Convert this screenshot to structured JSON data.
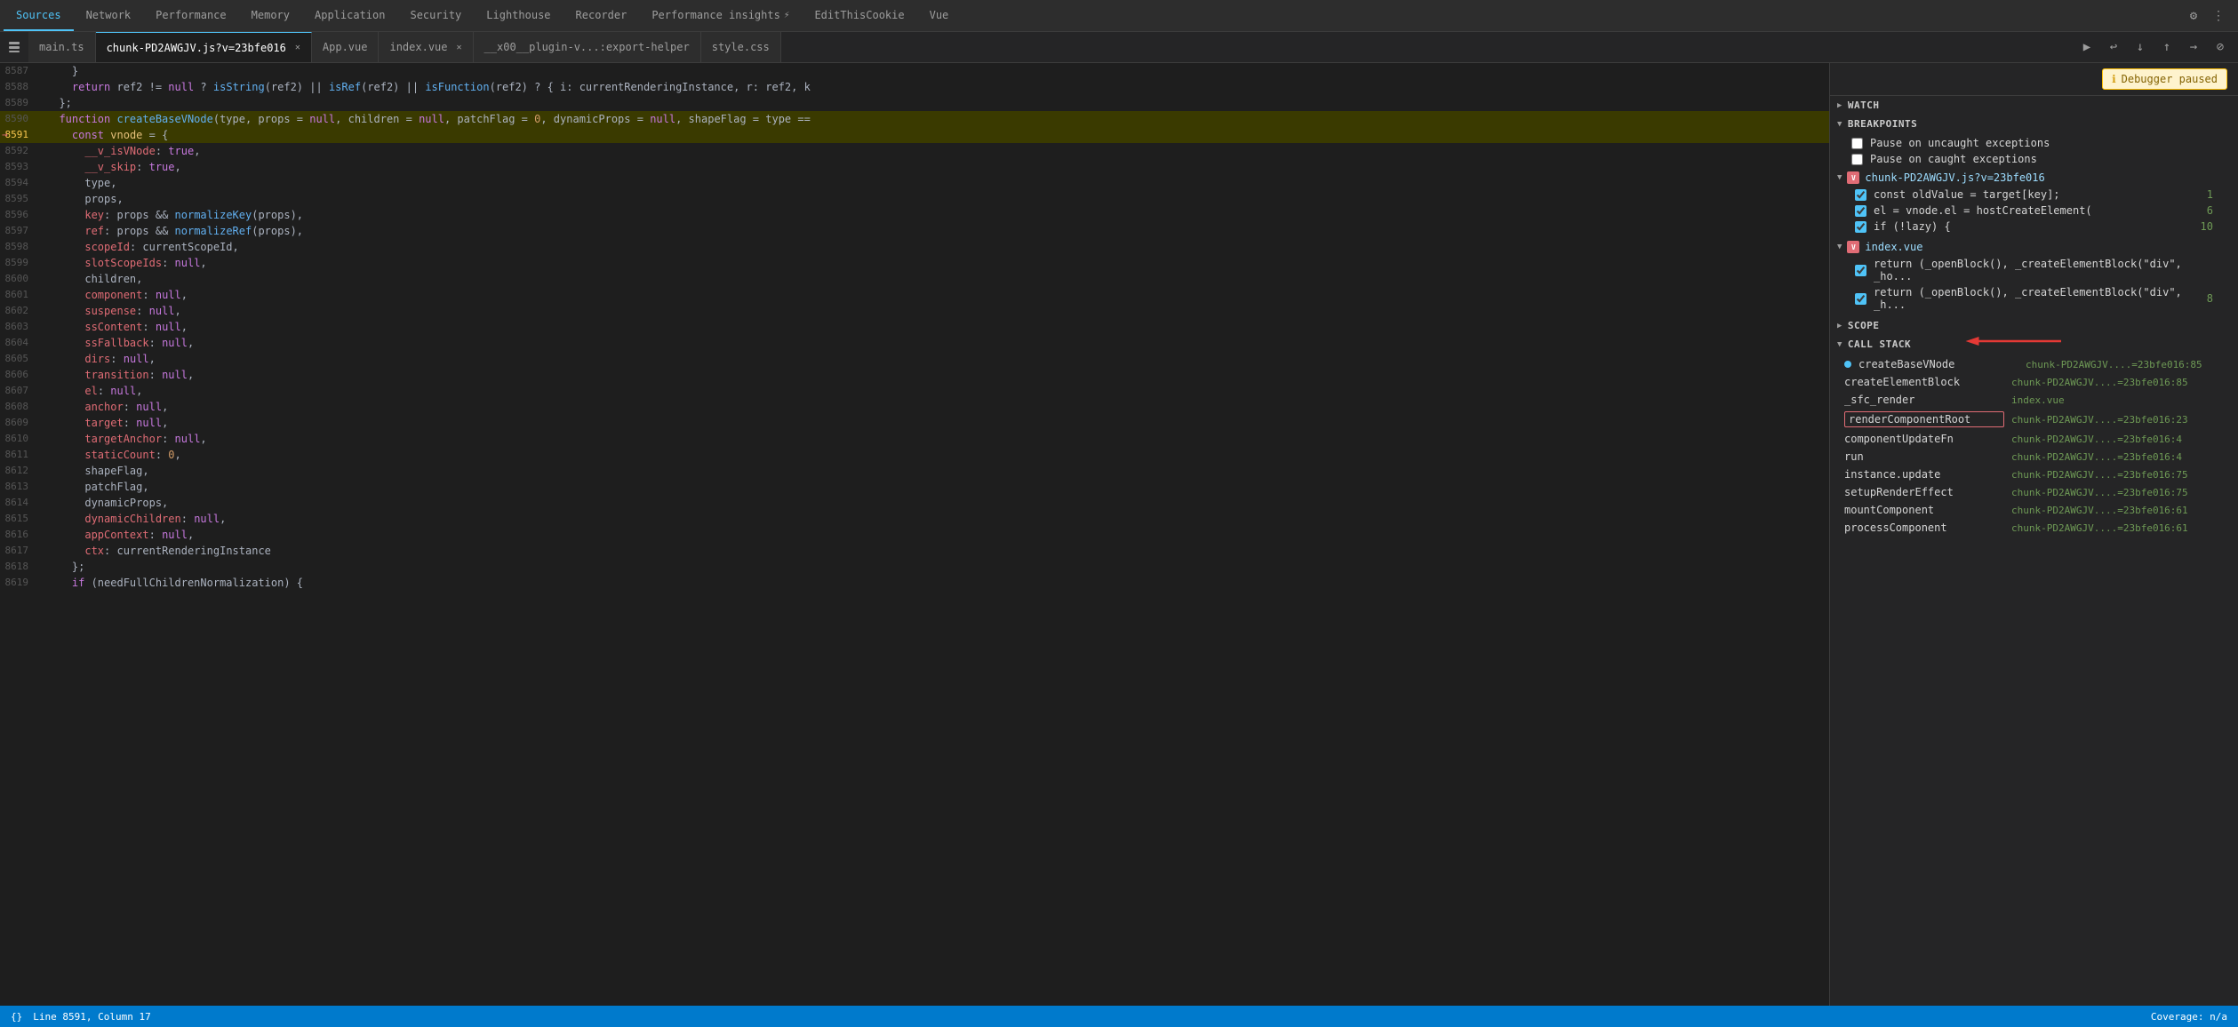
{
  "topTabs": {
    "items": [
      {
        "label": "Sources",
        "active": true
      },
      {
        "label": "Network",
        "active": false
      },
      {
        "label": "Performance",
        "active": false
      },
      {
        "label": "Memory",
        "active": false
      },
      {
        "label": "Application",
        "active": false
      },
      {
        "label": "Security",
        "active": false
      },
      {
        "label": "Lighthouse",
        "active": false
      },
      {
        "label": "Recorder",
        "active": false
      },
      {
        "label": "Performance insights",
        "active": false
      },
      {
        "label": "EditThisCookie",
        "active": false
      },
      {
        "label": "Vue",
        "active": false
      }
    ]
  },
  "fileTabs": {
    "items": [
      {
        "label": "main.ts",
        "active": false,
        "hasClose": false
      },
      {
        "label": "chunk-PD2AWGJV.js?v=23bfe016",
        "active": true,
        "hasClose": true
      },
      {
        "label": "App.vue",
        "active": false,
        "hasClose": false
      },
      {
        "label": "index.vue",
        "active": false,
        "hasClose": true
      },
      {
        "label": "__x00__plugin-v...:export-helper",
        "active": false,
        "hasClose": false
      },
      {
        "label": "style.css",
        "active": false,
        "hasClose": false
      }
    ]
  },
  "debugger": {
    "banner": "Debugger paused",
    "bannerIcon": "ℹ"
  },
  "panelSections": {
    "watch": {
      "label": "Watch"
    },
    "breakpoints": {
      "label": "Breakpoints"
    },
    "pauseUncaught": {
      "label": "Pause on uncaught exceptions"
    },
    "pauseCaught": {
      "label": "Pause on caught exceptions"
    },
    "scope": {
      "label": "Scope"
    },
    "callStack": {
      "label": "Call Stack"
    }
  },
  "breakpointGroups": [
    {
      "file": "chunk-PD2AWGJV.js?v=23bfe016",
      "items": [
        {
          "code": "const oldValue = target[key];",
          "lineNum": "1",
          "checked": true
        },
        {
          "code": "el = vnode.el = hostCreateElement(",
          "lineNum": "6",
          "checked": true
        },
        {
          "code": "if (!lazy) {",
          "lineNum": "10",
          "checked": true
        }
      ]
    },
    {
      "file": "index.vue",
      "items": [
        {
          "code": "return (_openBlock(), _createElementBlock(\"div\", _ho...",
          "lineNum": "",
          "checked": true
        },
        {
          "code": "return (_openBlock(), _createElementBlock(\"div\", _h...",
          "lineNum": "8",
          "checked": true
        }
      ]
    }
  ],
  "callStackItems": [
    {
      "fn": "createBaseVNode",
      "file": "chunk-PD2AWGJV....=23bfe016:85",
      "selected": false,
      "hasDot": true
    },
    {
      "fn": "createElementBlock",
      "file": "chunk-PD2AWGJV....=23bfe016:85",
      "selected": false,
      "hasDot": false
    },
    {
      "fn": "_sfc_render",
      "file": "index.vue",
      "selected": false,
      "hasDot": false
    },
    {
      "fn": "renderComponentRoot",
      "file": "chunk-PD2AWGJV....=23bfe016:23",
      "selected": true,
      "hasDot": false
    },
    {
      "fn": "componentUpdateFn",
      "file": "chunk-PD2AWGJV....=23bfe016:4",
      "selected": false,
      "hasDot": false
    },
    {
      "fn": "run",
      "file": "chunk-PD2AWGJV....=23bfe016:4",
      "selected": false,
      "hasDot": false
    },
    {
      "fn": "instance.update",
      "file": "chunk-PD2AWGJV....=23bfe016:75",
      "selected": false,
      "hasDot": false
    },
    {
      "fn": "setupRenderEffect",
      "file": "chunk-PD2AWGJV....=23bfe016:75",
      "selected": false,
      "hasDot": false
    },
    {
      "fn": "mountComponent",
      "file": "chunk-PD2AWGJV....=23bfe016:61",
      "selected": false,
      "hasDot": false
    },
    {
      "fn": "processComponent",
      "file": "chunk-PD2AWGJV....=23bfe016:61",
      "selected": false,
      "hasDot": false
    }
  ],
  "codeLines": [
    {
      "num": "8587",
      "content": "    }"
    },
    {
      "num": "8588",
      "content": "    return ref2 != null ? isString(ref2) || isRef(ref2) || isFunction(ref2) ? { i: currentRenderingInstance, r: ref2, k"
    },
    {
      "num": "8589",
      "content": "  };"
    },
    {
      "num": "8590",
      "content": "  function createBaseVNode(type, props = null, children = null, patchFlag = 0, dynamicProps = null, shapeFlag = type ==",
      "highlighted": true
    },
    {
      "num": "8591",
      "content": "    const vnode = {",
      "highlighted": true,
      "arrow": true
    },
    {
      "num": "8592",
      "content": "      __v_isVNode: true,"
    },
    {
      "num": "8593",
      "content": "      __v_skip: true,"
    },
    {
      "num": "8594",
      "content": "      type,"
    },
    {
      "num": "8595",
      "content": "      props,"
    },
    {
      "num": "8596",
      "content": "      key: props && normalizeKey(props),"
    },
    {
      "num": "8597",
      "content": "      ref: props && normalizeRef(props),"
    },
    {
      "num": "8598",
      "content": "      scopeId: currentScopeId,"
    },
    {
      "num": "8599",
      "content": "      slotScopeIds: null,"
    },
    {
      "num": "8600",
      "content": "      children,"
    },
    {
      "num": "8601",
      "content": "      component: null,"
    },
    {
      "num": "8602",
      "content": "      suspense: null,"
    },
    {
      "num": "8603",
      "content": "      ssContent: null,"
    },
    {
      "num": "8604",
      "content": "      ssFallback: null,"
    },
    {
      "num": "8605",
      "content": "      dirs: null,"
    },
    {
      "num": "8606",
      "content": "      transition: null,"
    },
    {
      "num": "8607",
      "content": "      el: null,"
    },
    {
      "num": "8608",
      "content": "      anchor: null,"
    },
    {
      "num": "8609",
      "content": "      target: null,"
    },
    {
      "num": "8610",
      "content": "      targetAnchor: null,"
    },
    {
      "num": "8611",
      "content": "      staticCount: 0,"
    },
    {
      "num": "8612",
      "content": "      shapeFlag,"
    },
    {
      "num": "8613",
      "content": "      patchFlag,"
    },
    {
      "num": "8614",
      "content": "      dynamicProps,"
    },
    {
      "num": "8615",
      "content": "      dynamicChildren: null,"
    },
    {
      "num": "8616",
      "content": "      appContext: null,"
    },
    {
      "num": "8617",
      "content": "      ctx: currentRenderingInstance"
    },
    {
      "num": "8618",
      "content": "    };"
    },
    {
      "num": "8619",
      "content": "    if (needFullChildrenNormalization) {"
    }
  ],
  "statusBar": {
    "lineCol": "Line 8591, Column 17",
    "coverage": "Coverage: n/a"
  }
}
